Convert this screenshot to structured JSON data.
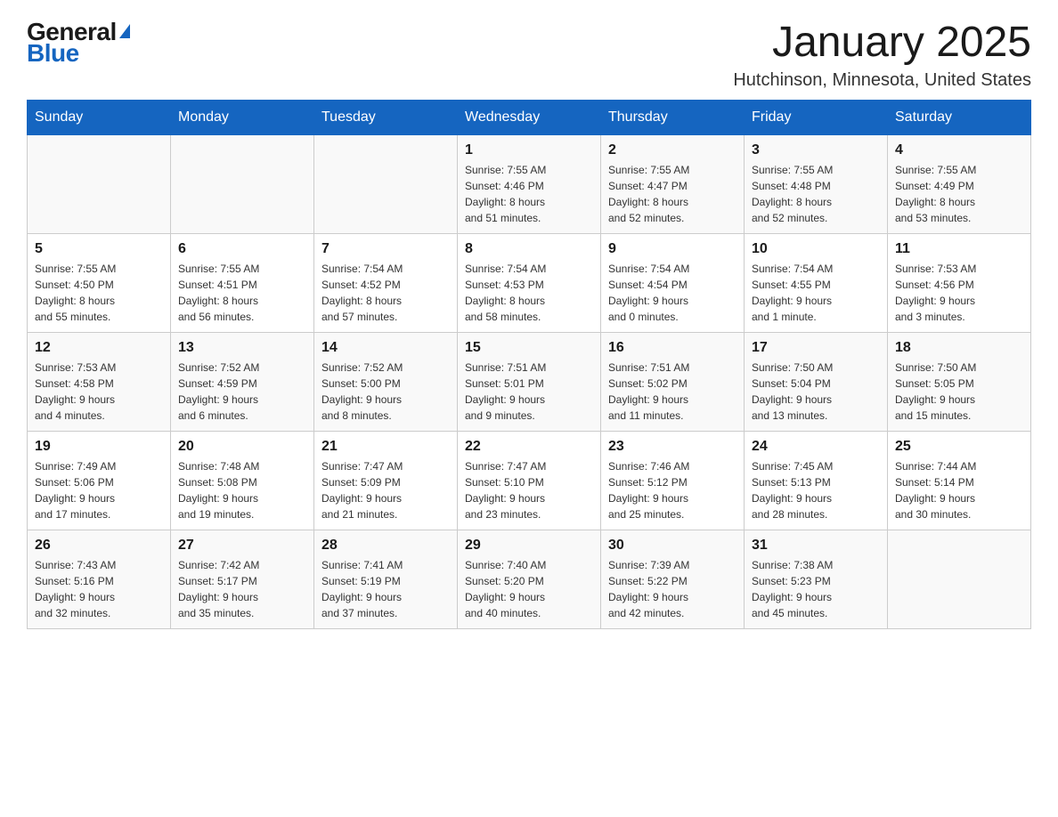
{
  "logo": {
    "general": "General",
    "blue": "Blue"
  },
  "title": "January 2025",
  "subtitle": "Hutchinson, Minnesota, United States",
  "days": [
    "Sunday",
    "Monday",
    "Tuesday",
    "Wednesday",
    "Thursday",
    "Friday",
    "Saturday"
  ],
  "weeks": [
    [
      {
        "day": "",
        "info": ""
      },
      {
        "day": "",
        "info": ""
      },
      {
        "day": "",
        "info": ""
      },
      {
        "day": "1",
        "info": "Sunrise: 7:55 AM\nSunset: 4:46 PM\nDaylight: 8 hours\nand 51 minutes."
      },
      {
        "day": "2",
        "info": "Sunrise: 7:55 AM\nSunset: 4:47 PM\nDaylight: 8 hours\nand 52 minutes."
      },
      {
        "day": "3",
        "info": "Sunrise: 7:55 AM\nSunset: 4:48 PM\nDaylight: 8 hours\nand 52 minutes."
      },
      {
        "day": "4",
        "info": "Sunrise: 7:55 AM\nSunset: 4:49 PM\nDaylight: 8 hours\nand 53 minutes."
      }
    ],
    [
      {
        "day": "5",
        "info": "Sunrise: 7:55 AM\nSunset: 4:50 PM\nDaylight: 8 hours\nand 55 minutes."
      },
      {
        "day": "6",
        "info": "Sunrise: 7:55 AM\nSunset: 4:51 PM\nDaylight: 8 hours\nand 56 minutes."
      },
      {
        "day": "7",
        "info": "Sunrise: 7:54 AM\nSunset: 4:52 PM\nDaylight: 8 hours\nand 57 minutes."
      },
      {
        "day": "8",
        "info": "Sunrise: 7:54 AM\nSunset: 4:53 PM\nDaylight: 8 hours\nand 58 minutes."
      },
      {
        "day": "9",
        "info": "Sunrise: 7:54 AM\nSunset: 4:54 PM\nDaylight: 9 hours\nand 0 minutes."
      },
      {
        "day": "10",
        "info": "Sunrise: 7:54 AM\nSunset: 4:55 PM\nDaylight: 9 hours\nand 1 minute."
      },
      {
        "day": "11",
        "info": "Sunrise: 7:53 AM\nSunset: 4:56 PM\nDaylight: 9 hours\nand 3 minutes."
      }
    ],
    [
      {
        "day": "12",
        "info": "Sunrise: 7:53 AM\nSunset: 4:58 PM\nDaylight: 9 hours\nand 4 minutes."
      },
      {
        "day": "13",
        "info": "Sunrise: 7:52 AM\nSunset: 4:59 PM\nDaylight: 9 hours\nand 6 minutes."
      },
      {
        "day": "14",
        "info": "Sunrise: 7:52 AM\nSunset: 5:00 PM\nDaylight: 9 hours\nand 8 minutes."
      },
      {
        "day": "15",
        "info": "Sunrise: 7:51 AM\nSunset: 5:01 PM\nDaylight: 9 hours\nand 9 minutes."
      },
      {
        "day": "16",
        "info": "Sunrise: 7:51 AM\nSunset: 5:02 PM\nDaylight: 9 hours\nand 11 minutes."
      },
      {
        "day": "17",
        "info": "Sunrise: 7:50 AM\nSunset: 5:04 PM\nDaylight: 9 hours\nand 13 minutes."
      },
      {
        "day": "18",
        "info": "Sunrise: 7:50 AM\nSunset: 5:05 PM\nDaylight: 9 hours\nand 15 minutes."
      }
    ],
    [
      {
        "day": "19",
        "info": "Sunrise: 7:49 AM\nSunset: 5:06 PM\nDaylight: 9 hours\nand 17 minutes."
      },
      {
        "day": "20",
        "info": "Sunrise: 7:48 AM\nSunset: 5:08 PM\nDaylight: 9 hours\nand 19 minutes."
      },
      {
        "day": "21",
        "info": "Sunrise: 7:47 AM\nSunset: 5:09 PM\nDaylight: 9 hours\nand 21 minutes."
      },
      {
        "day": "22",
        "info": "Sunrise: 7:47 AM\nSunset: 5:10 PM\nDaylight: 9 hours\nand 23 minutes."
      },
      {
        "day": "23",
        "info": "Sunrise: 7:46 AM\nSunset: 5:12 PM\nDaylight: 9 hours\nand 25 minutes."
      },
      {
        "day": "24",
        "info": "Sunrise: 7:45 AM\nSunset: 5:13 PM\nDaylight: 9 hours\nand 28 minutes."
      },
      {
        "day": "25",
        "info": "Sunrise: 7:44 AM\nSunset: 5:14 PM\nDaylight: 9 hours\nand 30 minutes."
      }
    ],
    [
      {
        "day": "26",
        "info": "Sunrise: 7:43 AM\nSunset: 5:16 PM\nDaylight: 9 hours\nand 32 minutes."
      },
      {
        "day": "27",
        "info": "Sunrise: 7:42 AM\nSunset: 5:17 PM\nDaylight: 9 hours\nand 35 minutes."
      },
      {
        "day": "28",
        "info": "Sunrise: 7:41 AM\nSunset: 5:19 PM\nDaylight: 9 hours\nand 37 minutes."
      },
      {
        "day": "29",
        "info": "Sunrise: 7:40 AM\nSunset: 5:20 PM\nDaylight: 9 hours\nand 40 minutes."
      },
      {
        "day": "30",
        "info": "Sunrise: 7:39 AM\nSunset: 5:22 PM\nDaylight: 9 hours\nand 42 minutes."
      },
      {
        "day": "31",
        "info": "Sunrise: 7:38 AM\nSunset: 5:23 PM\nDaylight: 9 hours\nand 45 minutes."
      },
      {
        "day": "",
        "info": ""
      }
    ]
  ]
}
